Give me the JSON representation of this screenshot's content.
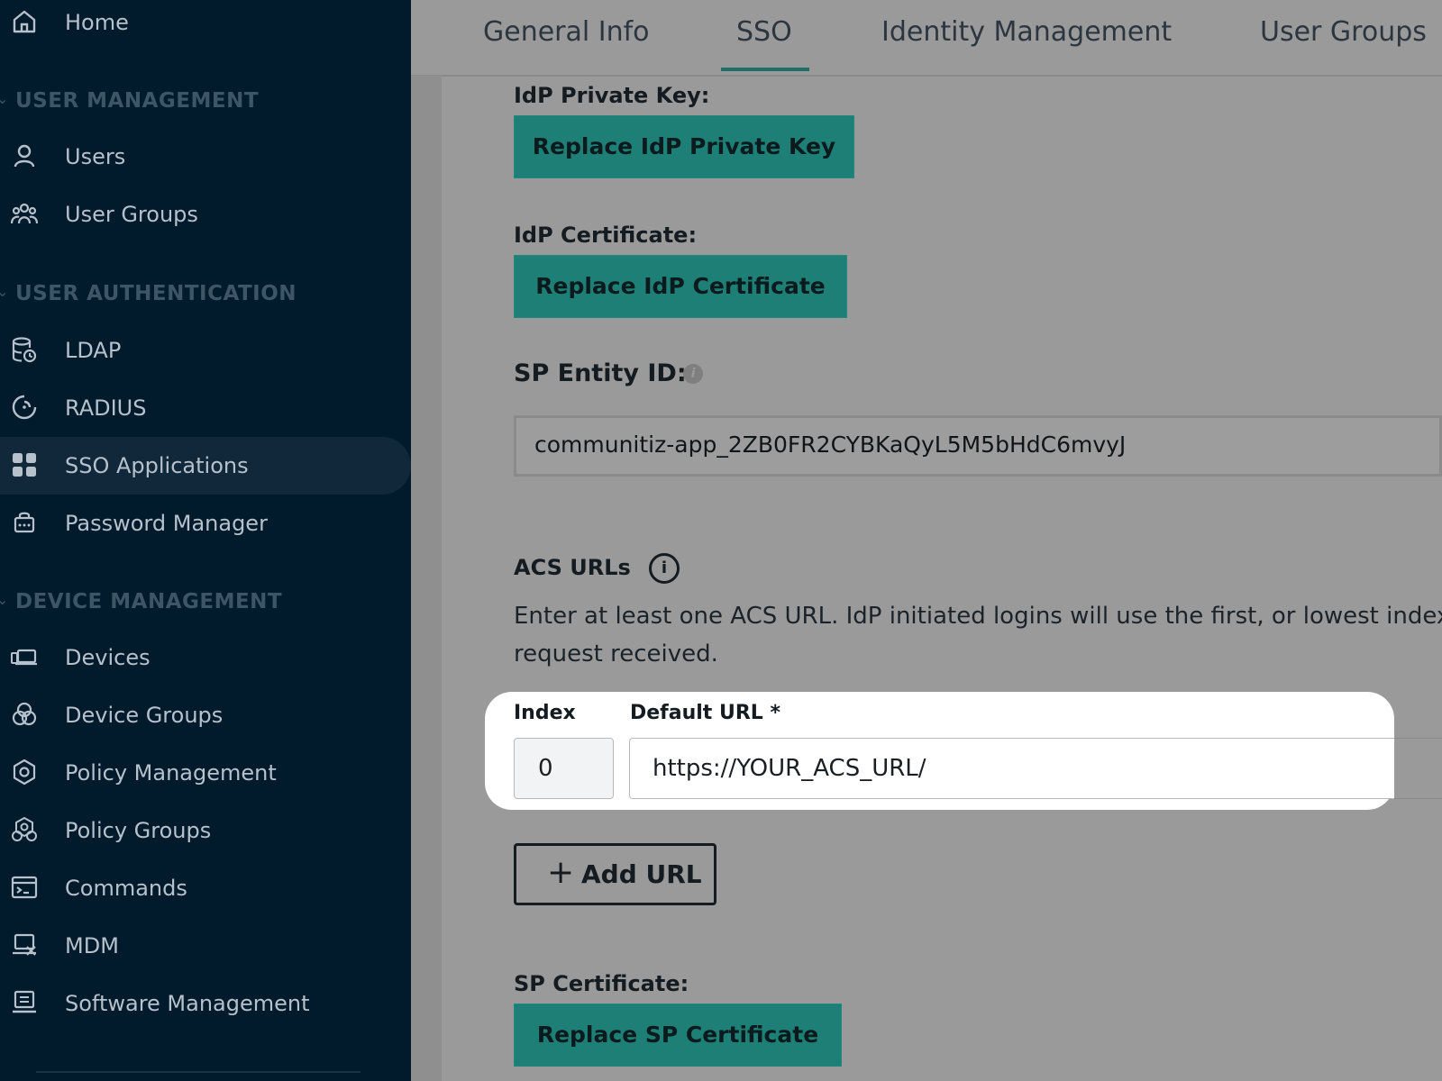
{
  "sidebar": {
    "home": "Home",
    "sections": {
      "user_management": "USER MANAGEMENT",
      "user_authentication": "USER AUTHENTICATION",
      "device_management": "DEVICE MANAGEMENT"
    },
    "items": {
      "users": "Users",
      "user_groups": "User Groups",
      "ldap": "LDAP",
      "radius": "RADIUS",
      "sso_applications": "SSO Applications",
      "password_manager": "Password Manager",
      "devices": "Devices",
      "device_groups": "Device Groups",
      "policy_management": "Policy Management",
      "policy_groups": "Policy Groups",
      "commands": "Commands",
      "mdm": "MDM",
      "software_management": "Software Management"
    },
    "active_item": "SSO Applications"
  },
  "tabs": {
    "general_info": "General Info",
    "sso": "SSO",
    "identity_management": "Identity Management",
    "user_groups": "User Groups",
    "active": "SSO"
  },
  "form": {
    "idp_private_key_label": "IdP Private Key:",
    "replace_idp_private_key": "Replace IdP Private Key",
    "idp_certificate_label": "IdP Certificate:",
    "replace_idp_certificate": "Replace IdP Certificate",
    "sp_entity_id_label": "SP Entity ID:",
    "sp_entity_id_value": "communitiz-app_2ZB0FR2CYBKaQyL5M5bHdC6mvyJ",
    "acs_urls_label": "ACS URLs",
    "acs_help_line1": "Enter at least one ACS URL. IdP initiated logins will use the first, or lowest index,",
    "acs_help_line2": "request received.",
    "index_label": "Index",
    "default_url_label": "Default URL *",
    "index_value": "0",
    "default_url_value": "https://YOUR_ACS_URL/",
    "add_url_plus": "+",
    "add_url": "Add URL",
    "sp_certificate_label": "SP Certificate:",
    "replace_sp_certificate": "Replace SP Certificate",
    "info_glyph": "i"
  },
  "colors": {
    "sidebar_bg": "#011a2c",
    "accent_teal": "#1e7f77",
    "overlay_gray": "#9a9a9a",
    "highlight": "#ffffff"
  }
}
